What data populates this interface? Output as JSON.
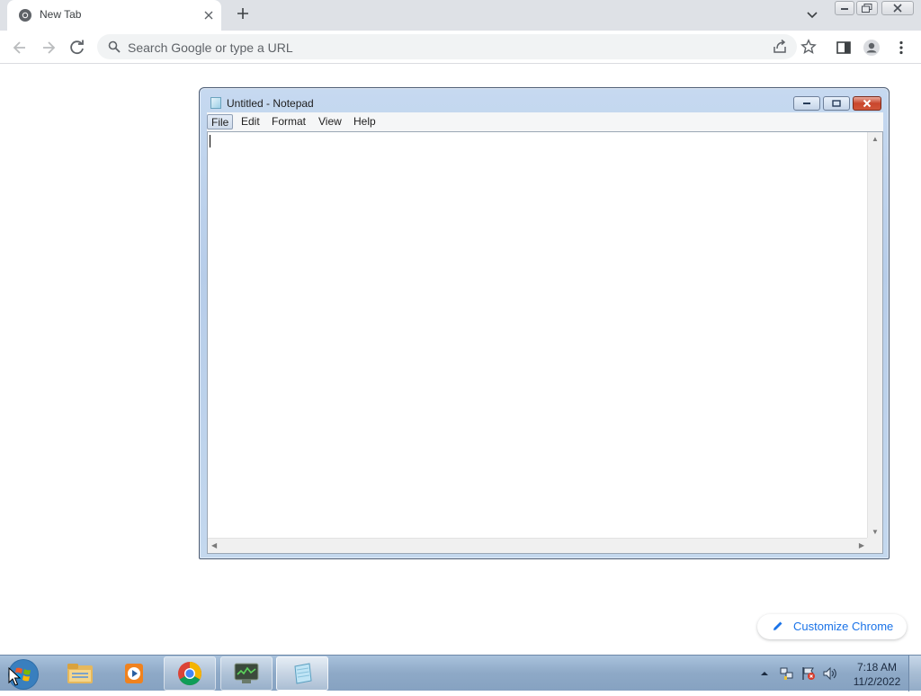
{
  "browser": {
    "tab": {
      "title": "New Tab",
      "favicon": "chrome-logo-icon",
      "close_icon": "close-icon"
    },
    "new_tab_icon": "plus-icon",
    "tab_search_icon": "chevron-down-icon",
    "window_controls": [
      "minimize-icon",
      "restore-icon",
      "close-icon"
    ],
    "toolbar": {
      "back_icon": "arrow-left-icon",
      "forward_icon": "arrow-right-icon",
      "reload_icon": "reload-icon",
      "omnibox": {
        "placeholder": "Search Google or type a URL",
        "search_icon": "search-icon",
        "share_icon": "share-icon",
        "bookmark_icon": "star-icon"
      },
      "side_panel_icon": "side-panel-icon",
      "profile_icon": "person-icon",
      "menu_icon": "more-vert-icon"
    },
    "customize": {
      "label": "Customize Chrome",
      "icon": "pencil-icon"
    }
  },
  "notepad": {
    "title": "Untitled - Notepad",
    "menus": [
      "File",
      "Edit",
      "Format",
      "View",
      "Help"
    ],
    "active_menu": "File",
    "content": ""
  },
  "taskbar": {
    "start_icon": "windows-start-orb-icon",
    "apps": [
      {
        "name": "file-explorer",
        "icon": "folder-icon",
        "state": "pinned"
      },
      {
        "name": "media-player",
        "icon": "media-play-icon",
        "state": "pinned"
      },
      {
        "name": "chrome",
        "icon": "chrome-logo-icon",
        "state": "open"
      },
      {
        "name": "task-monitor",
        "icon": "monitor-chart-icon",
        "state": "open"
      },
      {
        "name": "notepad",
        "icon": "notepad-icon",
        "state": "active"
      }
    ],
    "tray": {
      "icons": [
        "show-hidden-icons-arrow-icon",
        "network-icon",
        "action-center-flag-icon",
        "volume-icon"
      ],
      "time": "7:18 AM",
      "date": "11/2/2022"
    }
  },
  "colors": {
    "chrome_tabstrip": "#dee1e6",
    "omnibox_bg": "#f1f3f4",
    "link_blue": "#1a73e8",
    "notepad_frame": "#b7cde9",
    "taskbar": "#8ea9c7"
  }
}
